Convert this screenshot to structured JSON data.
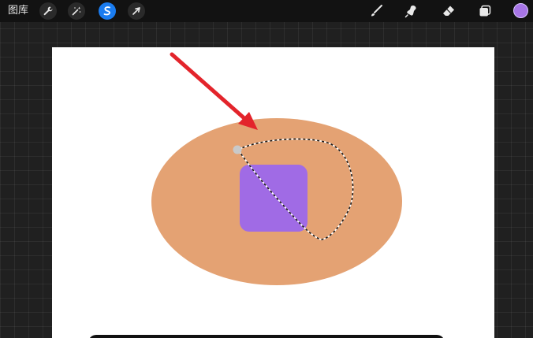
{
  "toolbar": {
    "gallery_label": "图库",
    "left_tools": [
      {
        "name": "wrench-icon",
        "role": "actions"
      },
      {
        "name": "magic-wand-icon",
        "role": "adjustments"
      },
      {
        "name": "selection-s-icon",
        "role": "selection",
        "active": true
      },
      {
        "name": "arrow-cursor-icon",
        "role": "transform"
      }
    ],
    "right_tools": [
      {
        "name": "brush-icon",
        "role": "paint"
      },
      {
        "name": "smudge-icon",
        "role": "smudge"
      },
      {
        "name": "eraser-icon",
        "role": "erase"
      },
      {
        "name": "layers-icon",
        "role": "layers"
      }
    ],
    "active_tool_color": "#1a7cf0",
    "current_color": "#a775e6"
  },
  "canvas": {
    "background": "#ffffff",
    "ellipse_color": "#e4a273",
    "square_color": "#a06be5",
    "arrow_color": "#e3242b"
  }
}
